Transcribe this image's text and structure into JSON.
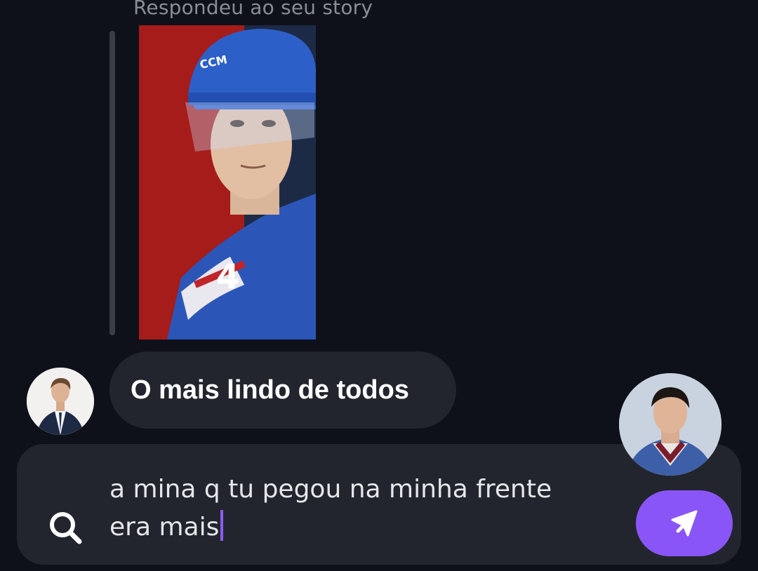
{
  "story": {
    "reply_label": "Respondeu ao seu story"
  },
  "messages": [
    {
      "sender": "other",
      "text": "O mais lindo de todos"
    }
  ],
  "composer": {
    "line1": "a mina q tu pegou na minha frente",
    "line2": "era mais"
  },
  "icons": {
    "search": "search-icon",
    "send": "send-icon"
  },
  "colors": {
    "background": "#0e111a",
    "bubble": "#22252e",
    "accent": "#8a55f7"
  }
}
